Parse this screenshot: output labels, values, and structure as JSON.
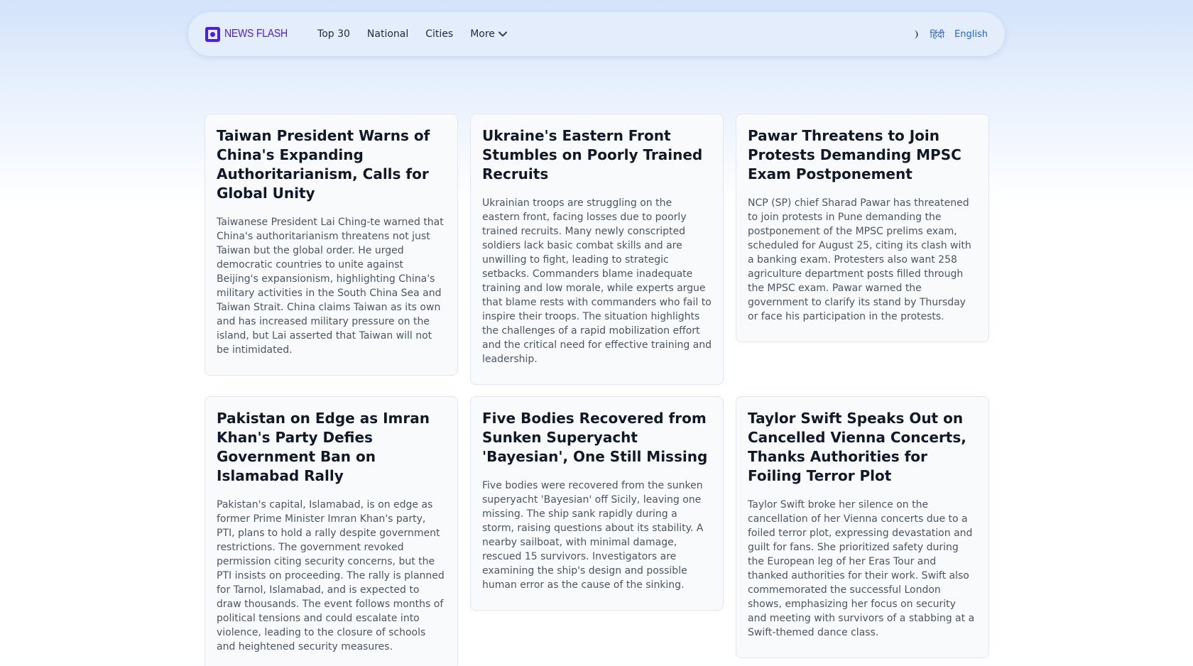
{
  "nav": {
    "logo_text": "NEWS FLASH",
    "links": [
      "Top 30",
      "National",
      "Cities"
    ],
    "more_label": "More",
    "lang_hindi": "हिंदी",
    "lang_english": "English"
  },
  "colors": {
    "brand": "#4c1fe0",
    "link_blue": "#2563eb",
    "card_bg": "#f8fafc"
  },
  "articles": [
    {
      "title": "Taiwan President Warns of China's Expanding Authoritarianism, Calls for Global Unity",
      "summary": "Taiwanese President Lai Ching-te warned that China's authoritarianism threatens not just Taiwan but the global order. He urged democratic countries to unite against Beijing's expansionism, highlighting China's military activities in the South China Sea and Taiwan Strait. China claims Taiwan as its own and has increased military pressure on the island, but Lai asserted that Taiwan will not be intimidated."
    },
    {
      "title": "Ukraine's Eastern Front Stumbles on Poorly Trained Recruits",
      "summary": "Ukrainian troops are struggling on the eastern front, facing losses due to poorly trained recruits. Many newly conscripted soldiers lack basic combat skills and are unwilling to fight, leading to strategic setbacks. Commanders blame inadequate training and low morale, while experts argue that blame rests with commanders who fail to inspire their troops. The situation highlights the challenges of a rapid mobilization effort and the critical need for effective training and leadership."
    },
    {
      "title": "Pawar Threatens to Join Protests Demanding MPSC Exam Postponement",
      "summary": "NCP (SP) chief Sharad Pawar has threatened to join protests in Pune demanding the postponement of the MPSC prelims exam, scheduled for August 25, citing its clash with a banking exam. Protesters also want 258 agriculture department posts filled through the MPSC exam. Pawar warned the government to clarify its stand by Thursday or face his participation in the protests."
    },
    {
      "title": "Pakistan on Edge as Imran Khan's Party Defies Government Ban on Islamabad Rally",
      "summary": "Pakistan's capital, Islamabad, is on edge as former Prime Minister Imran Khan's party, PTI, plans to hold a rally despite government restrictions. The government revoked permission citing security concerns, but the PTI insists on proceeding. The rally is planned for Tarnol, Islamabad, and is expected to draw thousands. The event follows months of political tensions and could escalate into violence, leading to the closure of schools and heightened security measures."
    },
    {
      "title": "Five Bodies Recovered from Sunken Superyacht 'Bayesian', One Still Missing",
      "summary": "Five bodies were recovered from the sunken superyacht 'Bayesian' off Sicily, leaving one missing. The ship sank rapidly during a storm, raising questions about its stability. A nearby sailboat, with minimal damage, rescued 15 survivors. Investigators are examining the ship's design and possible human error as the cause of the sinking."
    },
    {
      "title": "Taylor Swift Speaks Out on Cancelled Vienna Concerts, Thanks Authorities for Foiling Terror Plot",
      "summary": "Taylor Swift broke her silence on the cancellation of her Vienna concerts due to a foiled terror plot, expressing devastation and guilt for fans. She prioritized safety during the European leg of her Eras Tour and thanked authorities for their work. Swift also commemorated the successful London shows, emphasizing her focus on security and meeting with survivors of a stabbing at a Swift-themed dance class."
    }
  ]
}
